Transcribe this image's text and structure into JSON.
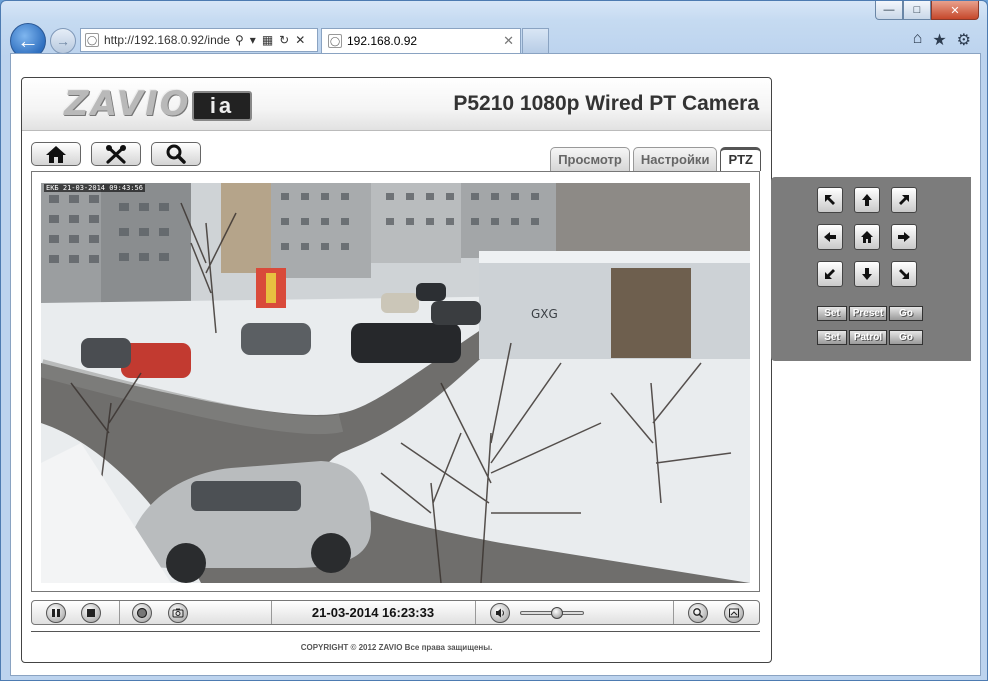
{
  "browser": {
    "url": "http://192.168.0.92/inde",
    "url_host": "192.168.0.92",
    "tab_title": "192.168.0.92"
  },
  "header": {
    "logo_text": "ZAVIO",
    "logo_badge": "ia",
    "camera_title": "P5210 1080p Wired PT Camera"
  },
  "toolbar": {
    "buttons": [
      {
        "name": "home-button",
        "icon": "home-icon"
      },
      {
        "name": "settings-button",
        "icon": "tools-icon"
      },
      {
        "name": "search-button",
        "icon": "search-icon"
      }
    ]
  },
  "tabs": [
    {
      "label": "Просмотр",
      "active": false
    },
    {
      "label": "Настройки",
      "active": false
    },
    {
      "label": "PTZ",
      "active": true
    }
  ],
  "video": {
    "overlay_stamp": "ЕКБ 21-03-2014 09:43:56"
  },
  "controls": {
    "datetime": "21-03-2014 16:23:33",
    "volume_level": 0.6
  },
  "ptz": {
    "preset": {
      "set": "Set",
      "label": "Preset",
      "go": "Go"
    },
    "patrol": {
      "set": "Set",
      "label": "Patrol",
      "go": "Go"
    }
  },
  "footer": {
    "copyright": "COPYRIGHT © 2012 ZAVIO Все права защищены."
  }
}
